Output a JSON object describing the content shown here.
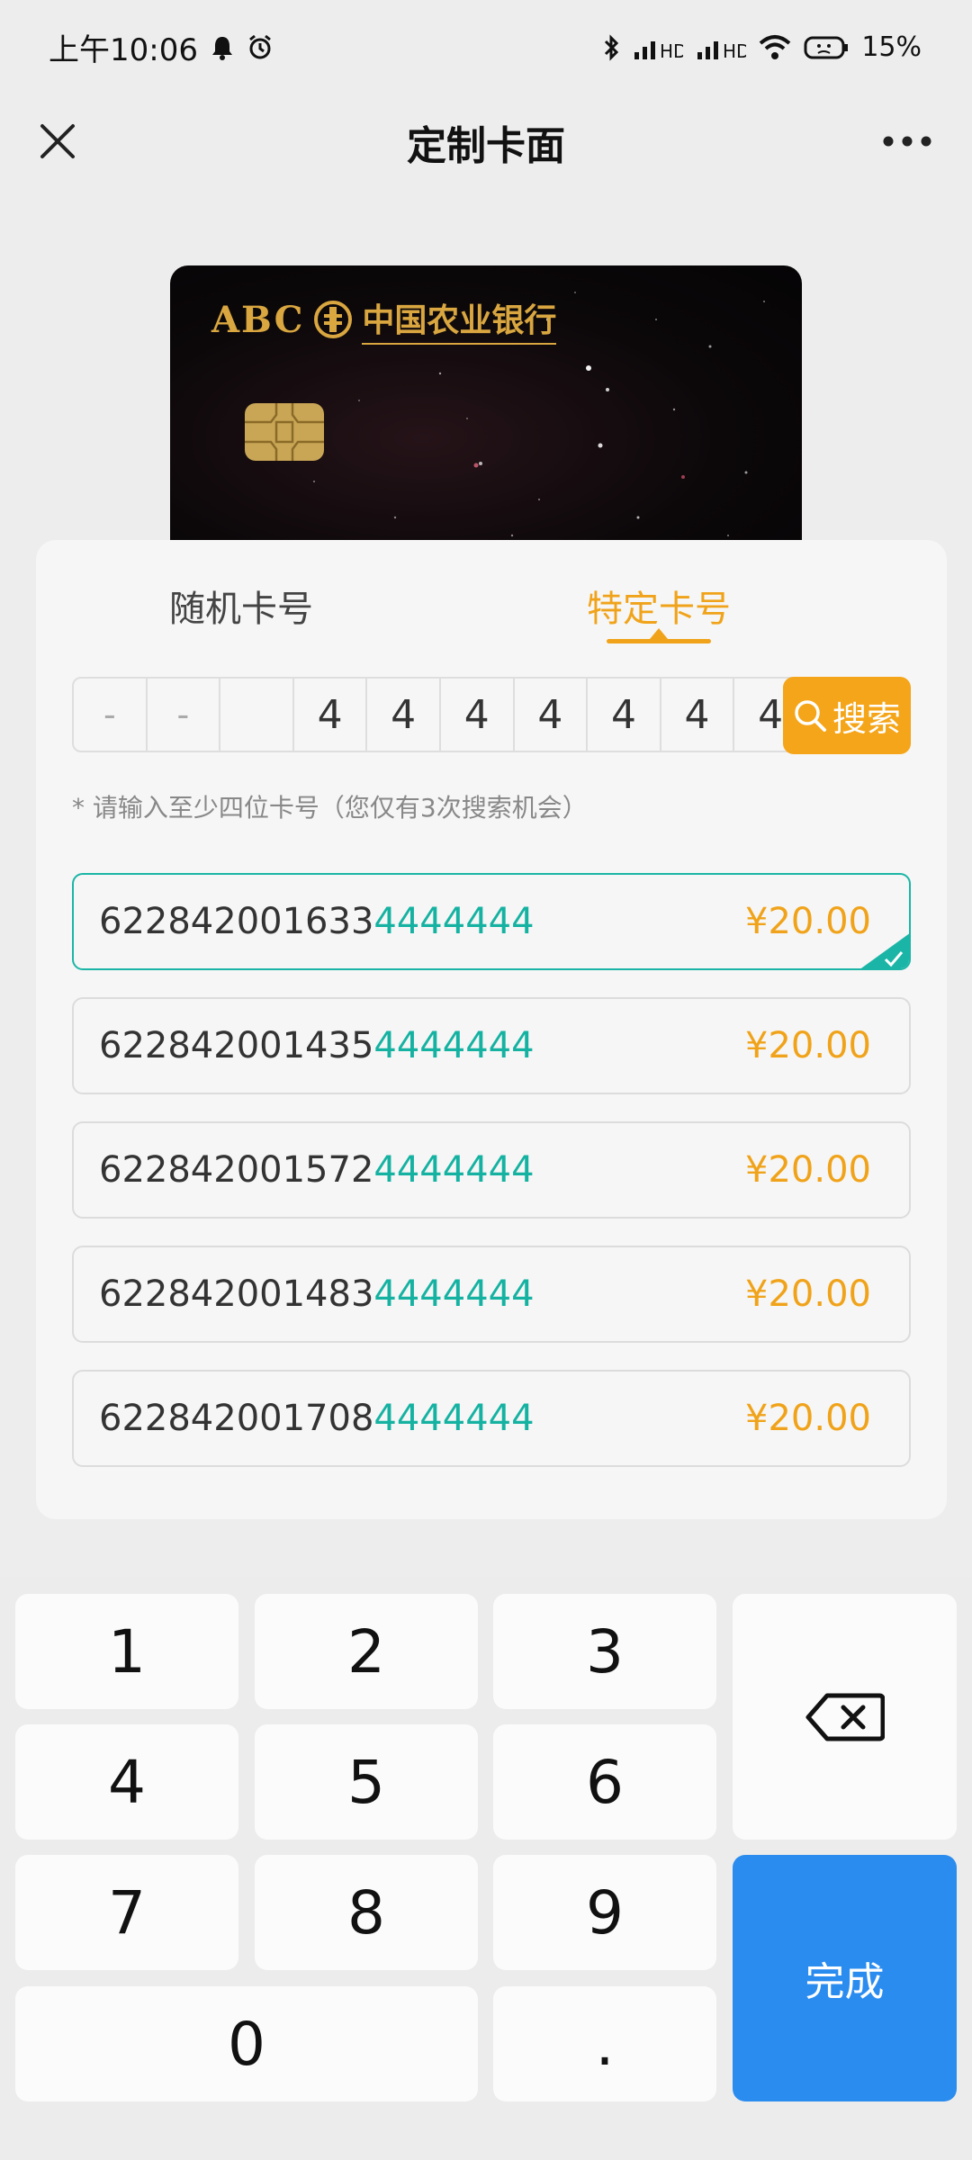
{
  "status_bar": {
    "time": "上午10:06",
    "battery": "15%",
    "icons": [
      "bell-icon",
      "alarm-icon",
      "bluetooth-icon",
      "signal-icon",
      "signal-icon",
      "wifi-icon",
      "battery-icon"
    ]
  },
  "nav": {
    "title": "定制卡面",
    "close_icon": "close-icon",
    "more_icon": "more-icon"
  },
  "card": {
    "logo_text": "ABC",
    "bank_name": "中国农业银行"
  },
  "tabs": [
    {
      "label": "随机卡号",
      "active": false
    },
    {
      "label": "特定卡号",
      "active": true
    }
  ],
  "digit_inputs": [
    "-",
    "-",
    "",
    "4",
    "4",
    "4",
    "4",
    "4",
    "4",
    "4"
  ],
  "search_button": "搜索",
  "hint": "* 请输入至少四位卡号（您仅有3次搜索机会）",
  "results": [
    {
      "prefix": "622842001633",
      "suffix": "4444444",
      "price": "¥20.00",
      "selected": true
    },
    {
      "prefix": "622842001435",
      "suffix": "4444444",
      "price": "¥20.00",
      "selected": false
    },
    {
      "prefix": "622842001572",
      "suffix": "4444444",
      "price": "¥20.00",
      "selected": false
    },
    {
      "prefix": "622842001483",
      "suffix": "4444444",
      "price": "¥20.00",
      "selected": false
    },
    {
      "prefix": "622842001708",
      "suffix": "4444444",
      "price": "¥20.00",
      "selected": false
    }
  ],
  "keypad": {
    "keys": [
      "1",
      "2",
      "3",
      "4",
      "5",
      "6",
      "7",
      "8",
      "9",
      "0",
      "."
    ],
    "done": "完成",
    "backspace_icon": "backspace-icon"
  },
  "colors": {
    "accent_orange": "#f0a31a",
    "accent_teal": "#15b2a2",
    "done_blue": "#2b8cf0"
  }
}
